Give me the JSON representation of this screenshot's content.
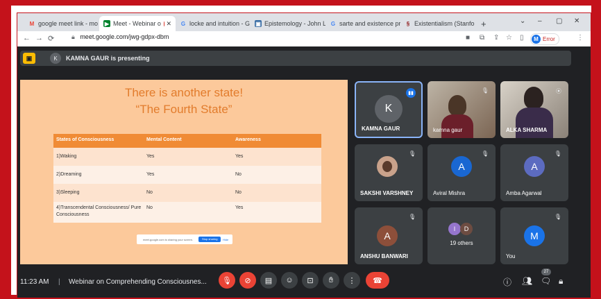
{
  "tabs": [
    {
      "label": "google meet link - mo",
      "icon": "gmail-icon",
      "active": false
    },
    {
      "label": "Meet - Webinar o",
      "icon": "google-meet-icon",
      "active": true
    },
    {
      "label": "locke and intuition - G",
      "icon": "google-search-icon",
      "active": false
    },
    {
      "label": "Epistemology - John L",
      "icon": "epistemology-site-icon",
      "active": false
    },
    {
      "label": "sarte and existence pr",
      "icon": "google-search-icon",
      "active": false
    },
    {
      "label": "Existentialism (Stanfo",
      "icon": "stanford-icon",
      "active": false
    }
  ],
  "new_tab": "+",
  "window_controls": {
    "dropdown": "⌄",
    "minimize": "–",
    "restore": "▢",
    "close": "✕"
  },
  "address_bar": {
    "url": "meet.google.com/jwg-gdpx-dbm"
  },
  "profile": {
    "initial": "M",
    "label": "Error"
  },
  "presenting": {
    "avatar": "K",
    "text": "KAMNA GAUR is presenting"
  },
  "slide": {
    "title_line1": "There is another state!",
    "title_line2": "“The Fourth State”",
    "table": {
      "headers": [
        "States of Consciousness",
        "Mental Content",
        "Awareness"
      ],
      "rows": [
        [
          "1)Waking",
          "Yes",
          "Yes"
        ],
        [
          "2)Dreaming",
          "Yes",
          "No"
        ],
        [
          "3)Sleeping",
          "No",
          "No"
        ],
        [
          "4)Transcendental Consciousness/ Pure Consciousness",
          "No",
          "Yes"
        ]
      ]
    },
    "share_bar": {
      "text": "meet.google.com is sharing your screen.",
      "stop": "Stop sharing",
      "hide": "Hide"
    }
  },
  "participants": [
    {
      "name": "KAMNA GAUR",
      "initial": "K",
      "avatar_color": "#5f6368",
      "speaking": true
    },
    {
      "name": "kamna gaur",
      "video": true
    },
    {
      "name": "ALKA SHARMA",
      "video": true
    },
    {
      "name": "SAKSHI VARSHNEY",
      "photo": true
    },
    {
      "name": "Aviral Mishra",
      "initial": "A",
      "avatar_color": "#1967d2"
    },
    {
      "name": "Amba Agarwal",
      "initial": "A",
      "avatar_color": "#5c6bc0"
    },
    {
      "name": "ANSHU BANWARI",
      "initial": "A",
      "avatar_color": "#8d4f3a"
    },
    {
      "name": "19 others",
      "initials": [
        "I",
        "D"
      ],
      "initial_colors": [
        "#9575cd",
        "#6d4c41"
      ]
    },
    {
      "name": "You",
      "initial": "M",
      "avatar_color": "#1a73e8"
    }
  ],
  "bottom": {
    "time": "11:23 AM",
    "separator": "|",
    "meeting_name": "Webinar on Comprehending Consciousnes...",
    "participant_count": "27"
  },
  "colors": {
    "accent": "#1a73e8",
    "danger": "#ea4335",
    "slide_bg": "#fcc99b",
    "table_header": "#f08b35",
    "meet_bg": "#202124"
  }
}
